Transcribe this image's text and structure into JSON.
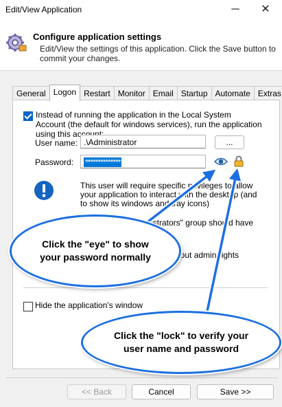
{
  "window": {
    "title": "Edit/View Application",
    "minimize": "─",
    "close": "✕"
  },
  "header": {
    "title": "Configure application settings",
    "description": "Edit/View the settings of this application. Click the Save button to commit your changes.",
    "icon": "gear-icon"
  },
  "tabs": [
    "General",
    "Logon",
    "Restart",
    "Monitor",
    "Email",
    "Startup",
    "Automate",
    "Extras"
  ],
  "active_tab": "Logon",
  "logon": {
    "use_account_label": "Instead of running the application in the Local System Account (the default for windows services), run the application using this account:",
    "use_account_checked": true,
    "username_label": "User name:",
    "username_value": ".\\Administrator",
    "browse_label": "...",
    "password_label": "Password:",
    "password_value": "**************",
    "info_text": "This user will require specific privileges to allow your application to interact with the desktop (and to show its windows and tray icons)",
    "info_text2": "istrators\" group should have the",
    "info_text3": "hout admin rights",
    "hide_windows_label": "Hide the application's window",
    "hide_windows_checked": false
  },
  "callouts": {
    "eye": "Click the \"eye\" to show your password normally",
    "lock": "Click the \"lock\" to verify your user name and password"
  },
  "footer": {
    "back_label": "<< Back",
    "cancel_label": "Cancel",
    "save_label": "Save >>"
  },
  "colors": {
    "accent": "#0078d7",
    "callout_border": "#1d6fe0",
    "info_icon": "#1565c0"
  }
}
